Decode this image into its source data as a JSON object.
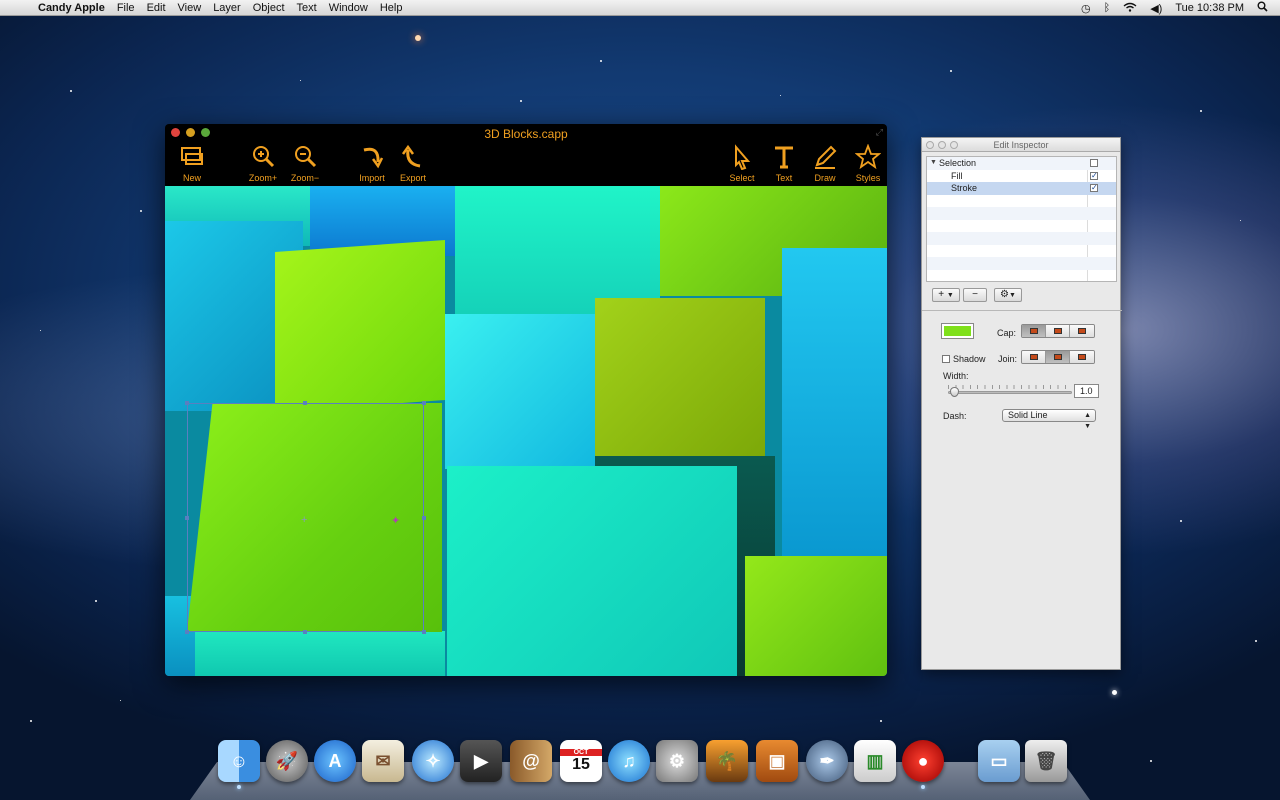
{
  "menubar": {
    "app_name": "Candy Apple",
    "menus": [
      "File",
      "Edit",
      "View",
      "Layer",
      "Object",
      "Text",
      "Window",
      "Help"
    ],
    "clock": "Tue 10:38 PM"
  },
  "window": {
    "title": "3D Blocks.capp",
    "toolbar": {
      "new": "New",
      "zoom_in": "Zoom+",
      "zoom_out": "Zoom−",
      "import": "Import",
      "export": "Export",
      "select": "Select",
      "text": "Text",
      "draw": "Draw",
      "styles": "Styles"
    }
  },
  "inspector": {
    "title": "Edit Inspector",
    "tree": {
      "root": "Selection",
      "items": [
        {
          "label": "Fill",
          "checked": true
        },
        {
          "label": "Stroke",
          "checked": true
        }
      ]
    },
    "stroke_color": "#7fe01a",
    "cap_label": "Cap:",
    "shadow_label": "Shadow",
    "join_label": "Join:",
    "width_label": "Width:",
    "width_value": "1.0",
    "dash_label": "Dash:",
    "dash_value": "Solid Line"
  },
  "dock": {
    "items": [
      "finder-icon",
      "launchpad-icon",
      "app-store-icon",
      "mail-icon",
      "safari-icon",
      "facetime-icon",
      "address-book-icon",
      "ical-icon",
      "itunes-icon",
      "system-preferences-icon",
      "iphoto-icon",
      "preview-icon",
      "image-capture-icon",
      "numbers-icon",
      "candy-apple-icon",
      "downloads-folder-icon",
      "trash-icon"
    ],
    "ical_month": "OCT",
    "ical_day": "15"
  }
}
